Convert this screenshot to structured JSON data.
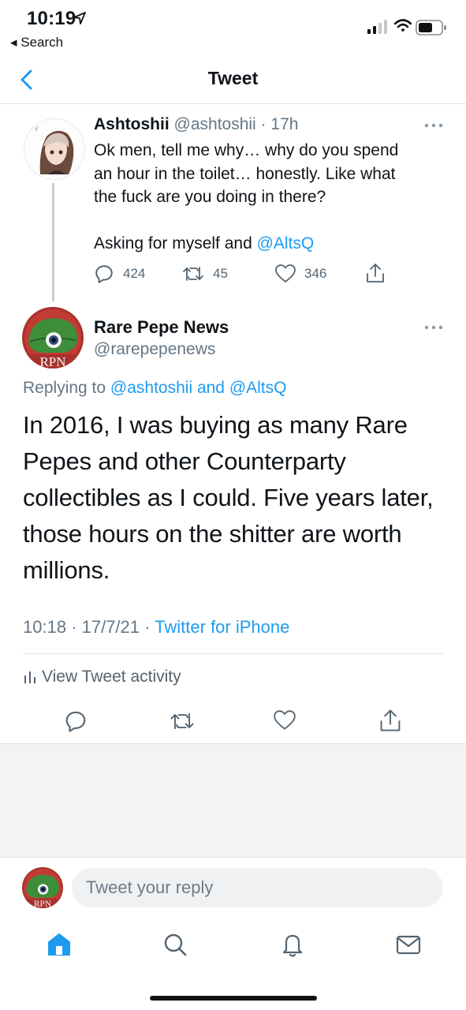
{
  "status_bar": {
    "time": "10:19",
    "back_label": "◂ Search"
  },
  "header": {
    "title": "Tweet"
  },
  "parent_tweet": {
    "author_name": "Ashtoshii",
    "handle": "@ashtoshii",
    "time_ago": "· 17h",
    "body_lines": [
      "Ok men, tell me why… why do you spend",
      "an hour in the toilet… honestly. Like what",
      "the fuck are you doing in there?"
    ],
    "body_tail": "Asking for myself and ",
    "mention": "@AltsQ",
    "reply_count": "424",
    "retweet_count": "45",
    "like_count": "346"
  },
  "main_tweet": {
    "author_name": "Rare Pepe News",
    "handle": "@rarepepenews",
    "replying_prefix": "Replying to ",
    "replying_to": "@ashtoshii and @AltsQ",
    "body": "In 2016, I was buying as many Rare Pepes and other Counterparty collectibles as I could. Five years later, those hours on the shitter are worth millions.",
    "avatar_text": "RPN",
    "timestamp": "10:18 · 17/7/21 · ",
    "source": "Twitter for iPhone",
    "activity_label": "View Tweet activity"
  },
  "reply_box": {
    "placeholder": "Tweet your reply"
  },
  "colors": {
    "accent": "#1d9bf0",
    "text": "#0f1419",
    "muted": "#536471",
    "pepe_green": "#3e8d3a",
    "avatar_red": "#a8322d"
  },
  "icons": [
    "location-arrow-icon",
    "signal-icon",
    "wifi-icon",
    "battery-icon",
    "chevron-left-icon",
    "more-icon",
    "reply-icon",
    "retweet-icon",
    "like-icon",
    "share-icon",
    "bar-chart-icon",
    "home-icon",
    "search-icon",
    "bell-icon",
    "mail-icon"
  ]
}
